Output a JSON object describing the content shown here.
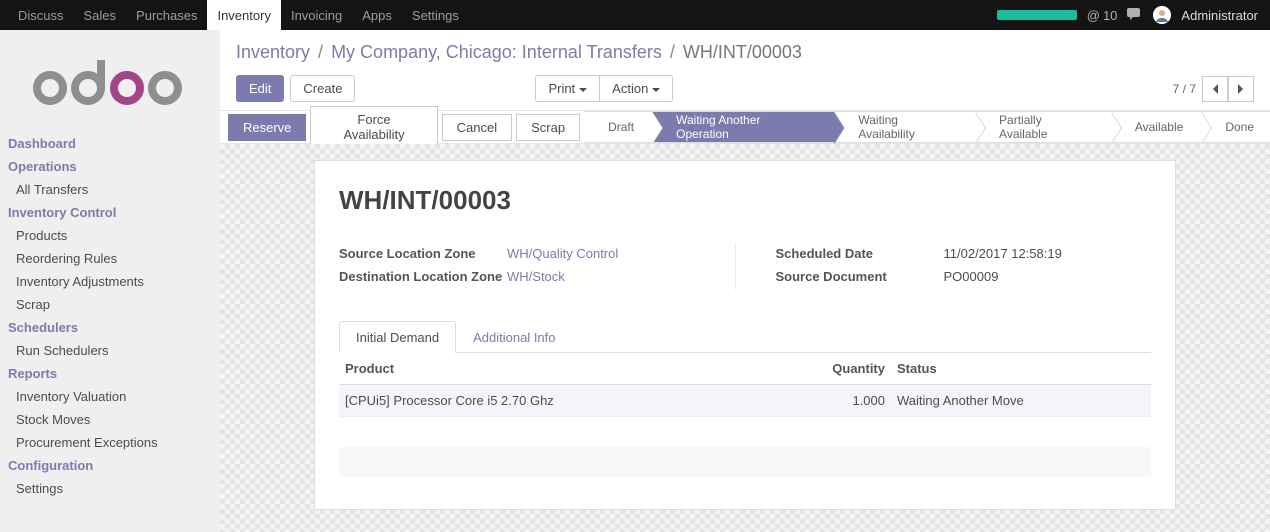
{
  "topnav": {
    "items": [
      "Discuss",
      "Sales",
      "Purchases",
      "Inventory",
      "Invoicing",
      "Apps",
      "Settings"
    ],
    "active_index": 3,
    "msg_count": "10",
    "username": "Administrator"
  },
  "sidebar": {
    "sections": [
      {
        "heading": "Dashboard",
        "links": []
      },
      {
        "heading": "Operations",
        "links": [
          "All Transfers"
        ]
      },
      {
        "heading": "Inventory Control",
        "links": [
          "Products",
          "Reordering Rules",
          "Inventory Adjustments",
          "Scrap"
        ]
      },
      {
        "heading": "Schedulers",
        "links": [
          "Run Schedulers"
        ]
      },
      {
        "heading": "Reports",
        "links": [
          "Inventory Valuation",
          "Stock Moves",
          "Procurement Exceptions"
        ]
      },
      {
        "heading": "Configuration",
        "links": [
          "Settings"
        ]
      }
    ]
  },
  "breadcrumb": {
    "root": "Inventory",
    "mid": "My Company, Chicago: Internal Transfers",
    "current": "WH/INT/00003"
  },
  "controls": {
    "edit": "Edit",
    "create": "Create",
    "print": "Print",
    "action": "Action",
    "pager": "7 / 7"
  },
  "statusbar": {
    "buttons": [
      {
        "label": "Reserve",
        "primary": true
      },
      {
        "label": "Force Availability",
        "primary": false
      },
      {
        "label": "Cancel",
        "primary": false
      },
      {
        "label": "Scrap",
        "primary": false
      }
    ],
    "stages": [
      "Draft",
      "Waiting Another Operation",
      "Waiting Availability",
      "Partially Available",
      "Available",
      "Done"
    ],
    "active_stage_index": 1
  },
  "record": {
    "title": "WH/INT/00003",
    "source_location_label": "Source Location Zone",
    "source_location": "WH/Quality Control",
    "dest_location_label": "Destination Location Zone",
    "dest_location": "WH/Stock",
    "scheduled_date_label": "Scheduled Date",
    "scheduled_date": "11/02/2017 12:58:19",
    "source_doc_label": "Source Document",
    "source_doc": "PO00009"
  },
  "tabs": [
    "Initial Demand",
    "Additional Info"
  ],
  "table": {
    "headers": {
      "product": "Product",
      "quantity": "Quantity",
      "status": "Status"
    },
    "rows": [
      {
        "product": "[CPUi5] Processor Core i5 2.70 Ghz",
        "quantity": "1.000",
        "status": "Waiting Another Move"
      }
    ]
  }
}
